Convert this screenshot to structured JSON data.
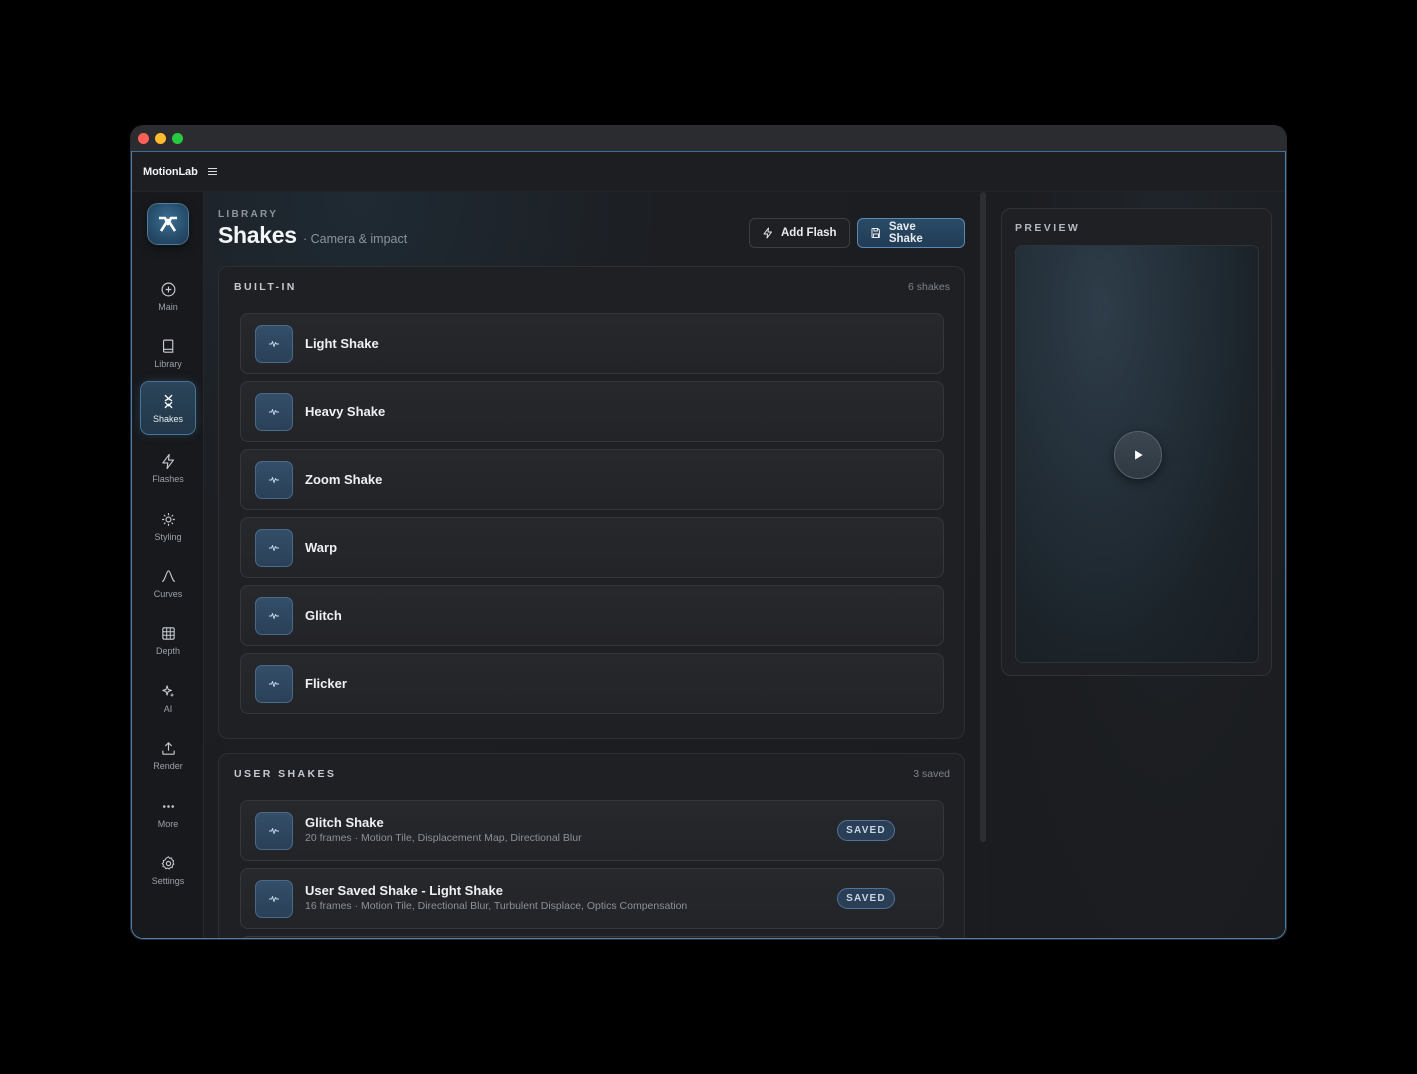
{
  "app": {
    "name": "MotionLab"
  },
  "sidebar": {
    "items": [
      {
        "label": "Main",
        "icon": "plus-circle-icon"
      },
      {
        "label": "Library",
        "icon": "book-icon"
      },
      {
        "label": "Shakes",
        "icon": "shake-icon",
        "active": true
      },
      {
        "label": "Flashes",
        "icon": "lightning-icon"
      },
      {
        "label": "Styling",
        "icon": "sun-icon"
      },
      {
        "label": "Curves",
        "icon": "curve-icon"
      },
      {
        "label": "Depth",
        "icon": "grid-icon"
      },
      {
        "label": "AI",
        "icon": "sparkle-icon"
      },
      {
        "label": "Render",
        "icon": "upload-icon"
      },
      {
        "label": "More",
        "icon": "dots-icon"
      },
      {
        "label": "Settings",
        "icon": "gear-icon"
      }
    ]
  },
  "header": {
    "eyebrow": "LIBRARY",
    "title": "Shakes",
    "subtitle": "· Camera & impact",
    "add_flash_label": "Add Flash",
    "save_shake_label": "Save Shake"
  },
  "builtin": {
    "heading": "BUILT-IN",
    "count": "6 shakes",
    "items": [
      {
        "title": "Light Shake"
      },
      {
        "title": "Heavy Shake"
      },
      {
        "title": "Zoom Shake"
      },
      {
        "title": "Warp"
      },
      {
        "title": "Glitch"
      },
      {
        "title": "Flicker"
      }
    ]
  },
  "user": {
    "heading": "USER SHAKES",
    "count": "3 saved",
    "items": [
      {
        "title": "Glitch Shake",
        "meta": "20 frames · Motion Tile, Displacement Map, Directional Blur",
        "badge": "SAVED"
      },
      {
        "title": "User Saved Shake - Light Shake",
        "meta": "16 frames · Motion Tile, Directional Blur, Turbulent Displace, Optics Compensation",
        "badge": "SAVED"
      }
    ]
  },
  "preview": {
    "label": "PREVIEW"
  },
  "colors": {
    "accent": "#4a7fb0",
    "badge_bg": "#2a3f56"
  }
}
